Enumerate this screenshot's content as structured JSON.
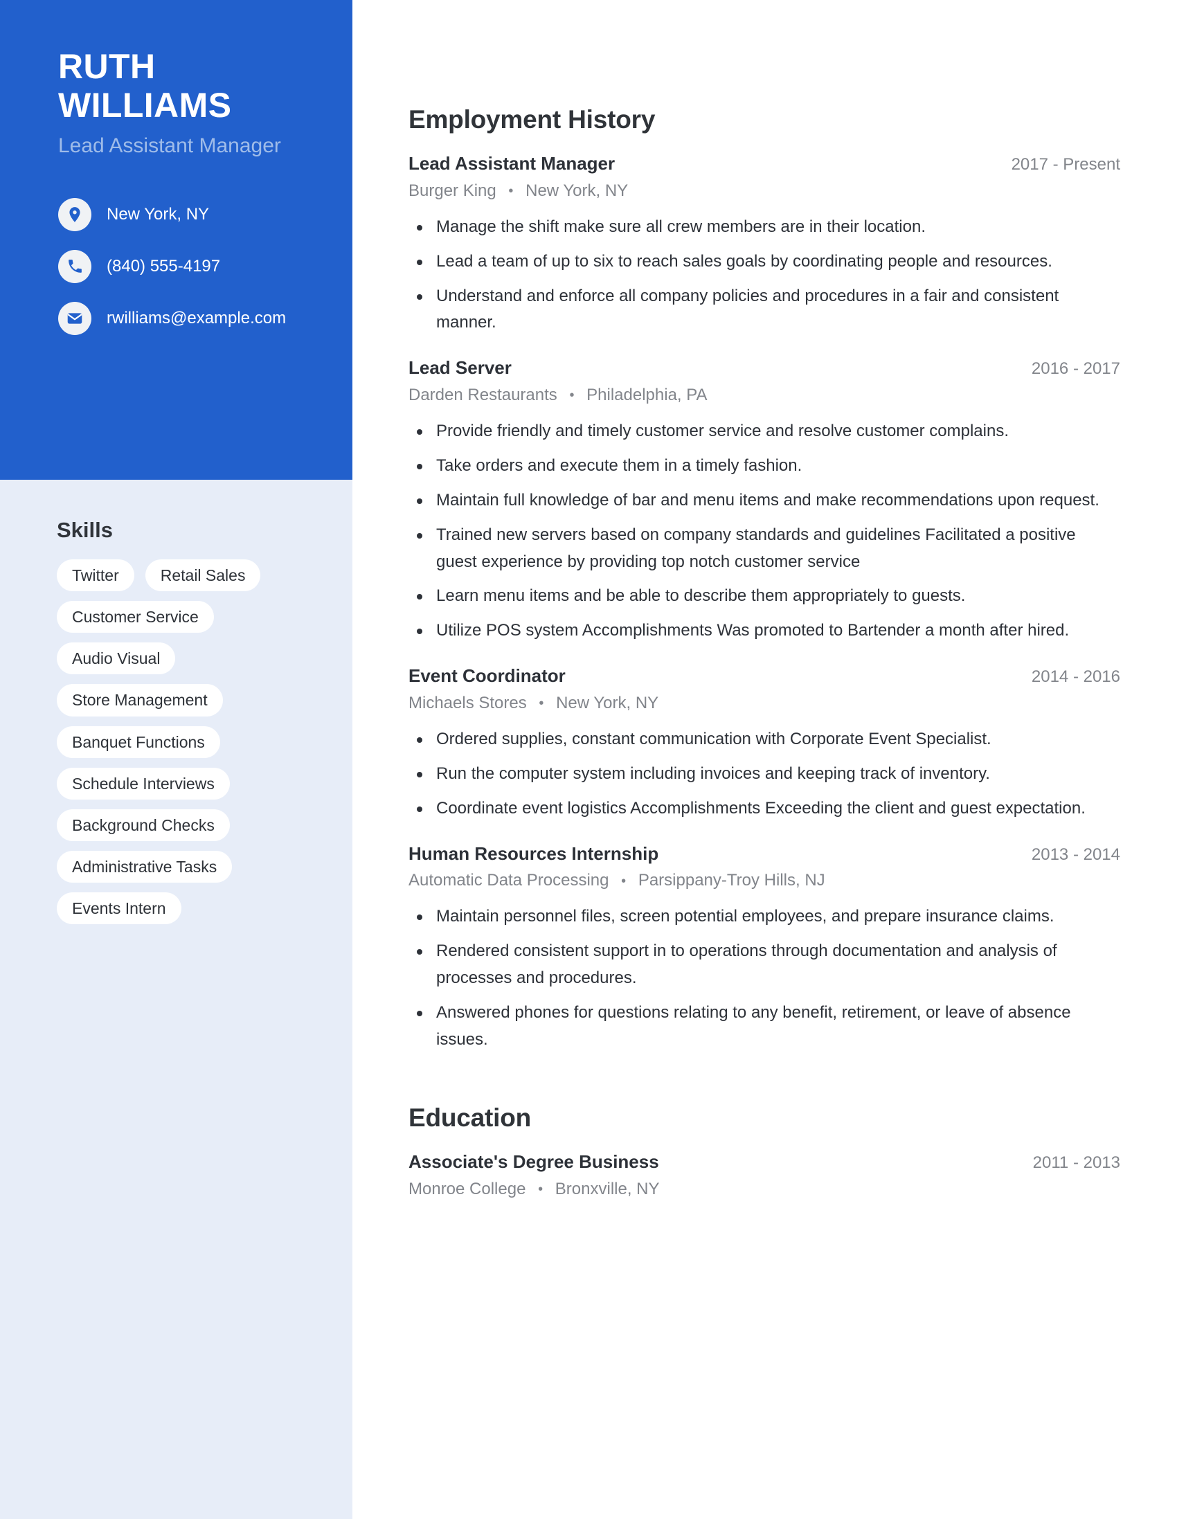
{
  "sidebar": {
    "name": "RUTH WILLIAMS",
    "job_title": "Lead Assistant Manager",
    "accent_color": "#2260cc",
    "sidebar_bg_color": "#e7edf8",
    "contact": [
      {
        "icon": "location-pin-icon",
        "value": "New York, NY"
      },
      {
        "icon": "phone-icon",
        "value": "(840) 555-4197"
      },
      {
        "icon": "envelope-icon",
        "value": "rwilliams@example.com"
      }
    ],
    "skills_heading": "Skills",
    "skills": [
      "Twitter",
      "Retail Sales",
      "Customer Service",
      "Audio Visual",
      "Store Management",
      "Banquet Functions",
      "Schedule Interviews",
      "Background Checks",
      "Administrative Tasks",
      "Events Intern"
    ]
  },
  "main": {
    "employment": {
      "heading": "Employment History",
      "entries": [
        {
          "title": "Lead Assistant Manager",
          "dates": "2017 - Present",
          "company": "Burger King",
          "location": "New York, NY",
          "bullets": [
            "Manage the shift make sure all crew members are in their location.",
            "Lead a team of up to six to reach sales goals by coordinating people and resources.",
            "Understand and enforce all company policies and procedures in a fair and consistent manner."
          ]
        },
        {
          "title": "Lead Server",
          "dates": "2016 - 2017",
          "company": "Darden Restaurants",
          "location": "Philadelphia, PA",
          "bullets": [
            "Provide friendly and timely customer service and resolve customer complains.",
            "Take orders and execute them in a timely fashion.",
            "Maintain full knowledge of bar and menu items and make recommendations upon request.",
            "Trained new servers based on company standards and guidelines Facilitated a positive guest experience by providing top notch customer service",
            "Learn menu items and be able to describe them appropriately to guests.",
            "Utilize POS system Accomplishments Was promoted to Bartender a month after hired."
          ]
        },
        {
          "title": "Event Coordinator",
          "dates": "2014 - 2016",
          "company": "Michaels Stores",
          "location": "New York, NY",
          "bullets": [
            "Ordered supplies, constant communication with Corporate Event Specialist.",
            "Run the computer system including invoices and keeping track of inventory.",
            "Coordinate event logistics Accomplishments Exceeding the client and guest expectation."
          ]
        },
        {
          "title": "Human Resources Internship",
          "dates": "2013 - 2014",
          "company": "Automatic Data Processing",
          "location": "Parsippany-Troy Hills, NJ",
          "bullets": [
            "Maintain personnel files, screen potential employees, and prepare insurance claims.",
            "Rendered consistent support in to operations through documentation and analysis of processes and procedures.",
            "Answered phones for questions relating to any benefit, retirement, or leave of absence issues."
          ]
        }
      ]
    },
    "education": {
      "heading": "Education",
      "entries": [
        {
          "title": "Associate's Degree Business",
          "dates": "2011 - 2013",
          "school": "Monroe College",
          "location": "Bronxville, NY"
        }
      ]
    }
  },
  "separator": "•"
}
